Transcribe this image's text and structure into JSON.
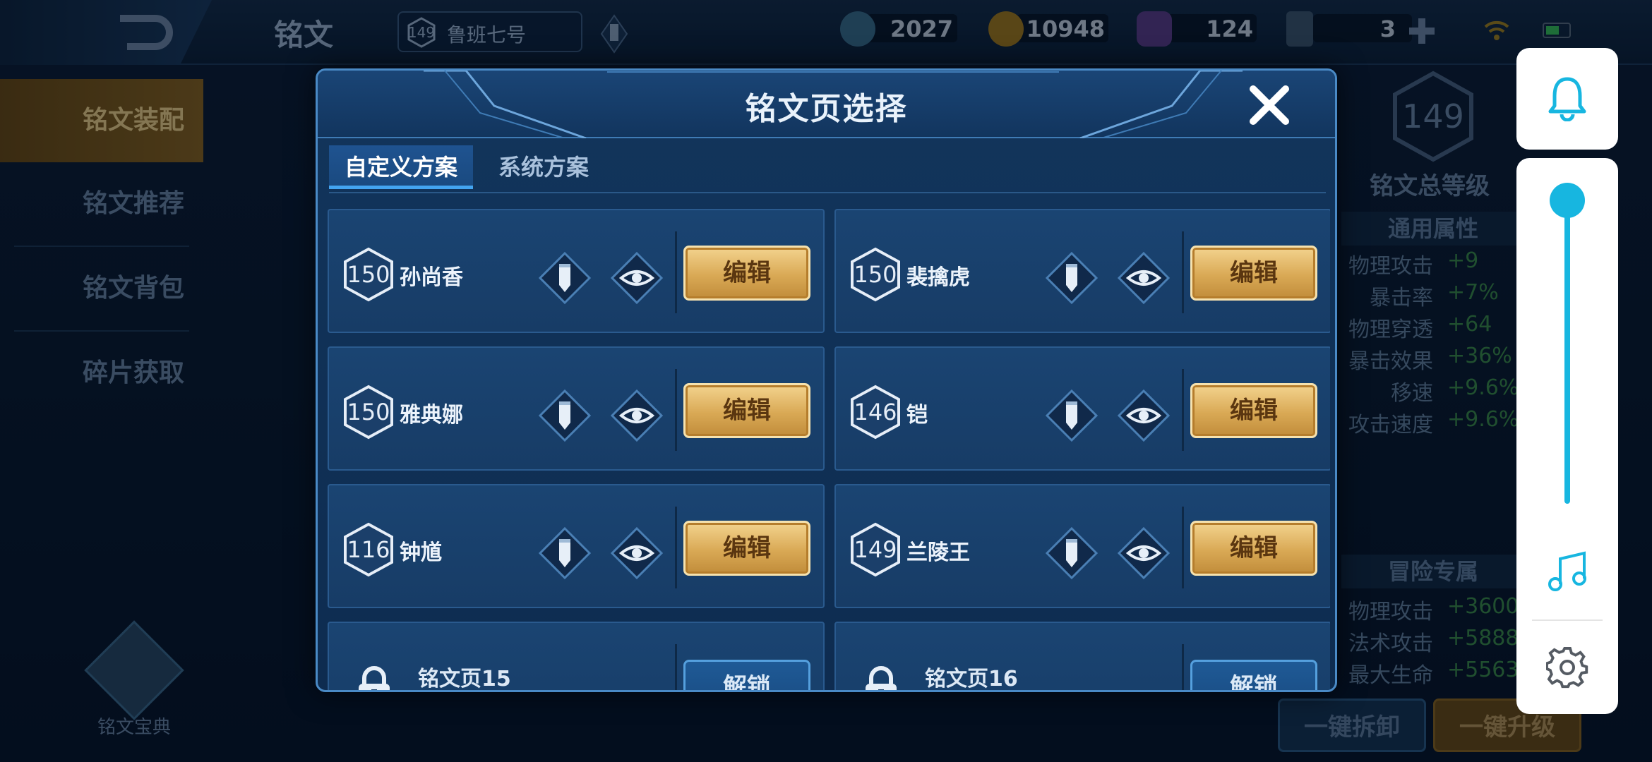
{
  "background": {
    "page_title": "铭文",
    "hero_chip": {
      "level": "149",
      "name": "鲁班七号"
    },
    "resources": [
      {
        "icon": "diamond-icon",
        "value": "2027"
      },
      {
        "icon": "gold-coin-icon",
        "value": "10948"
      },
      {
        "icon": "gem-icon",
        "value": "124"
      },
      {
        "icon": "card-icon",
        "value": "3"
      }
    ],
    "side_menu": [
      "铭文装配",
      "铭文推荐",
      "铭文背包",
      "碎片获取"
    ],
    "codex_label": "铭文宝典",
    "total_level": {
      "value": "149",
      "label": "铭文总等级"
    },
    "general_attrs": {
      "title": "通用属性",
      "rows": [
        {
          "name": "物理攻击",
          "value": "+9"
        },
        {
          "name": "暴击率",
          "value": "+7%"
        },
        {
          "name": "物理穿透",
          "value": "+64"
        },
        {
          "name": "暴击效果",
          "value": "+36%"
        },
        {
          "name": "移速",
          "value": "+9.6%"
        },
        {
          "name": "攻击速度",
          "value": "+9.6%"
        }
      ]
    },
    "adventure_attrs": {
      "title": "冒险专属",
      "rows": [
        {
          "name": "物理攻击",
          "value": "+3600"
        },
        {
          "name": "法术攻击",
          "value": "+5888"
        },
        {
          "name": "最大生命",
          "value": "+5563"
        }
      ]
    },
    "buttons": {
      "unload_all": "一键拆卸",
      "upgrade_all": "一键升级"
    }
  },
  "modal": {
    "title": "铭文页选择",
    "tabs": [
      {
        "label": "自定义方案",
        "active": true
      },
      {
        "label": "系统方案",
        "active": false
      }
    ],
    "pages": [
      {
        "level": "150",
        "hero": "孙尚香",
        "action": "编辑"
      },
      {
        "level": "150",
        "hero": "裴擒虎",
        "action": "编辑"
      },
      {
        "level": "150",
        "hero": "雅典娜",
        "action": "编辑"
      },
      {
        "level": "146",
        "hero": "铠",
        "action": "编辑"
      },
      {
        "level": "116",
        "hero": "钟馗",
        "action": "编辑"
      },
      {
        "level": "149",
        "hero": "兰陵王",
        "action": "编辑"
      }
    ],
    "locked_pages": [
      {
        "name": "铭文页15",
        "action": "解锁"
      },
      {
        "name": "铭文页16",
        "action": "解锁"
      }
    ]
  },
  "colors": {
    "accent_blue": "#17b6e0",
    "edit_gold": "#d9a955",
    "modal_border": "#4a8ac6",
    "active_tab_underline": "#43a4f0"
  },
  "float_panel": {
    "bell": "bell-icon",
    "volume_level": 1.0,
    "music": "music-note-icon",
    "settings": "gear-icon"
  }
}
